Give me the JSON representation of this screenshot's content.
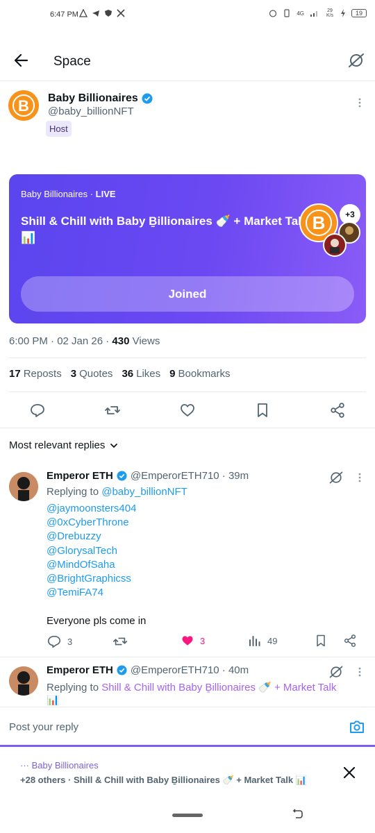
{
  "status_bar": {
    "time": "6:47 PM",
    "net_speed": "29\nK/s",
    "battery": "19",
    "network_label": "4G"
  },
  "header": {
    "title": "Space"
  },
  "host": {
    "name": "Baby Billionaires",
    "handle": "@baby_billionNFT",
    "badge": "Host",
    "avatar_color": "#f7931a"
  },
  "space_card": {
    "meta_name": "Baby Billionaires · ",
    "meta_live": "LIVE",
    "title": "Shill & Chill with Baby Ḇillionaires 🍼 + Market Talk 📊",
    "extra_count": "+3",
    "button_label": "Joined",
    "accent": "#6b48f2"
  },
  "post_meta": {
    "time_date": "6:00 PM · 02 Jan 26 · ",
    "views_count": "430",
    "views_label": " Views"
  },
  "stats": {
    "reposts_count": "17",
    "reposts_label": "Reposts",
    "quotes_count": "3",
    "quotes_label": "Quotes",
    "likes_count": "36",
    "likes_label": "Likes",
    "bookmarks_count": "9",
    "bookmarks_label": "Bookmarks"
  },
  "actions": [
    "reply-icon",
    "repost-icon",
    "like-icon",
    "bookmark-icon",
    "share-icon"
  ],
  "replies_filter": {
    "label": "Most relevant replies"
  },
  "replies": [
    {
      "name": "Emperor ETH",
      "handle": "@EmperorETH710 · 39m",
      "replying_prefix": "Replying to ",
      "replying_to": "@baby_billionNFT",
      "mentions": [
        "@jaymoonsters404",
        "@0xCyberThrone",
        "@Drebuzzy",
        "@GlorysalTech",
        "@MindOfSaha",
        "@BrightGraphicss",
        "@TemiFA74"
      ],
      "text": "Everyone pls come in",
      "reply_count": "3",
      "like_count": "3",
      "view_count": "49",
      "like_color": "#f91880"
    },
    {
      "name": "Emperor ETH",
      "handle": "@EmperorETH710 · 40m",
      "replying_prefix": "Replying to ",
      "replying_to": "Shill & Chill with Baby Ḇillionaires 🍼 + Market Talk",
      "replying_to_tail": "📊"
    }
  ],
  "compose": {
    "placeholder": "Post your reply"
  },
  "dock": {
    "host_line": "··· Baby Billionaires",
    "title": "+28 others · Shill & Chill with Baby Ḇillionaires 🍼 + Market Talk 📊"
  }
}
